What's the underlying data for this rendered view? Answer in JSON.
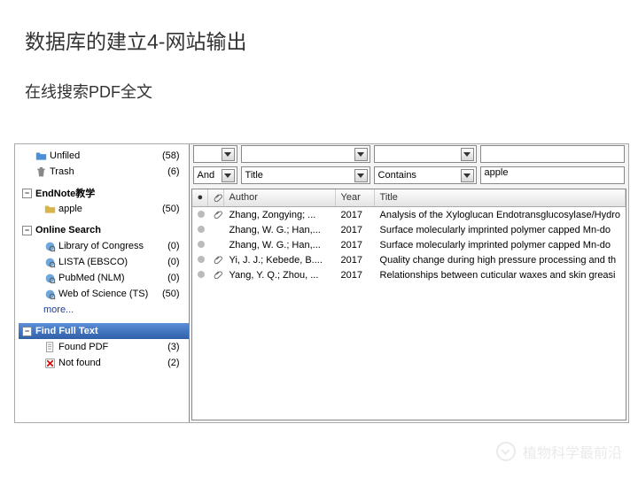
{
  "slide": {
    "title": "数据库的建立4-网站输出",
    "subtitle": "在线搜索PDF全文"
  },
  "sidebar": {
    "unfiled": {
      "label": "Unfiled",
      "count": "(58)"
    },
    "trash": {
      "label": "Trash",
      "count": "(6)"
    },
    "group_endnote": {
      "label": "EndNote教学"
    },
    "apple": {
      "label": "apple",
      "count": "(50)"
    },
    "group_online": {
      "label": "Online Search"
    },
    "loc": {
      "label": "Library of Congress",
      "count": "(0)"
    },
    "lista": {
      "label": "LISTA (EBSCO)",
      "count": "(0)"
    },
    "pubmed": {
      "label": "PubMed (NLM)",
      "count": "(0)"
    },
    "wos": {
      "label": "Web of Science (TS)",
      "count": "(50)"
    },
    "more": {
      "label": "more..."
    },
    "find_full": {
      "label": "Find Full Text"
    },
    "found_pdf": {
      "label": "Found PDF",
      "count": "(3)"
    },
    "not_found": {
      "label": "Not found",
      "count": "(2)"
    }
  },
  "search": {
    "row0": {
      "op": "",
      "field": "",
      "cond": "",
      "val": ""
    },
    "row1": {
      "op": "And",
      "field": "Title",
      "cond": "Contains",
      "val": "apple"
    }
  },
  "columns": {
    "author": "Author",
    "year": "Year",
    "title": "Title"
  },
  "rows": [
    {
      "clip": true,
      "author": "Zhang, Zongying; ...",
      "year": "2017",
      "title": "Analysis of the Xyloglucan Endotransglucosylase/Hydro"
    },
    {
      "clip": false,
      "author": "Zhang, W. G.; Han,...",
      "year": "2017",
      "title": "Surface molecularly imprinted polymer capped Mn-do"
    },
    {
      "clip": false,
      "author": "Zhang, W. G.; Han,...",
      "year": "2017",
      "title": "Surface molecularly imprinted polymer capped Mn-do"
    },
    {
      "clip": true,
      "author": "Yi, J. J.; Kebede, B....",
      "year": "2017",
      "title": "Quality change during high pressure processing and th"
    },
    {
      "clip": true,
      "author": "Yang, Y. Q.; Zhou, ...",
      "year": "2017",
      "title": "Relationships between cuticular waxes and skin greasi"
    }
  ],
  "watermark": {
    "text": "植物科学最前沿"
  }
}
